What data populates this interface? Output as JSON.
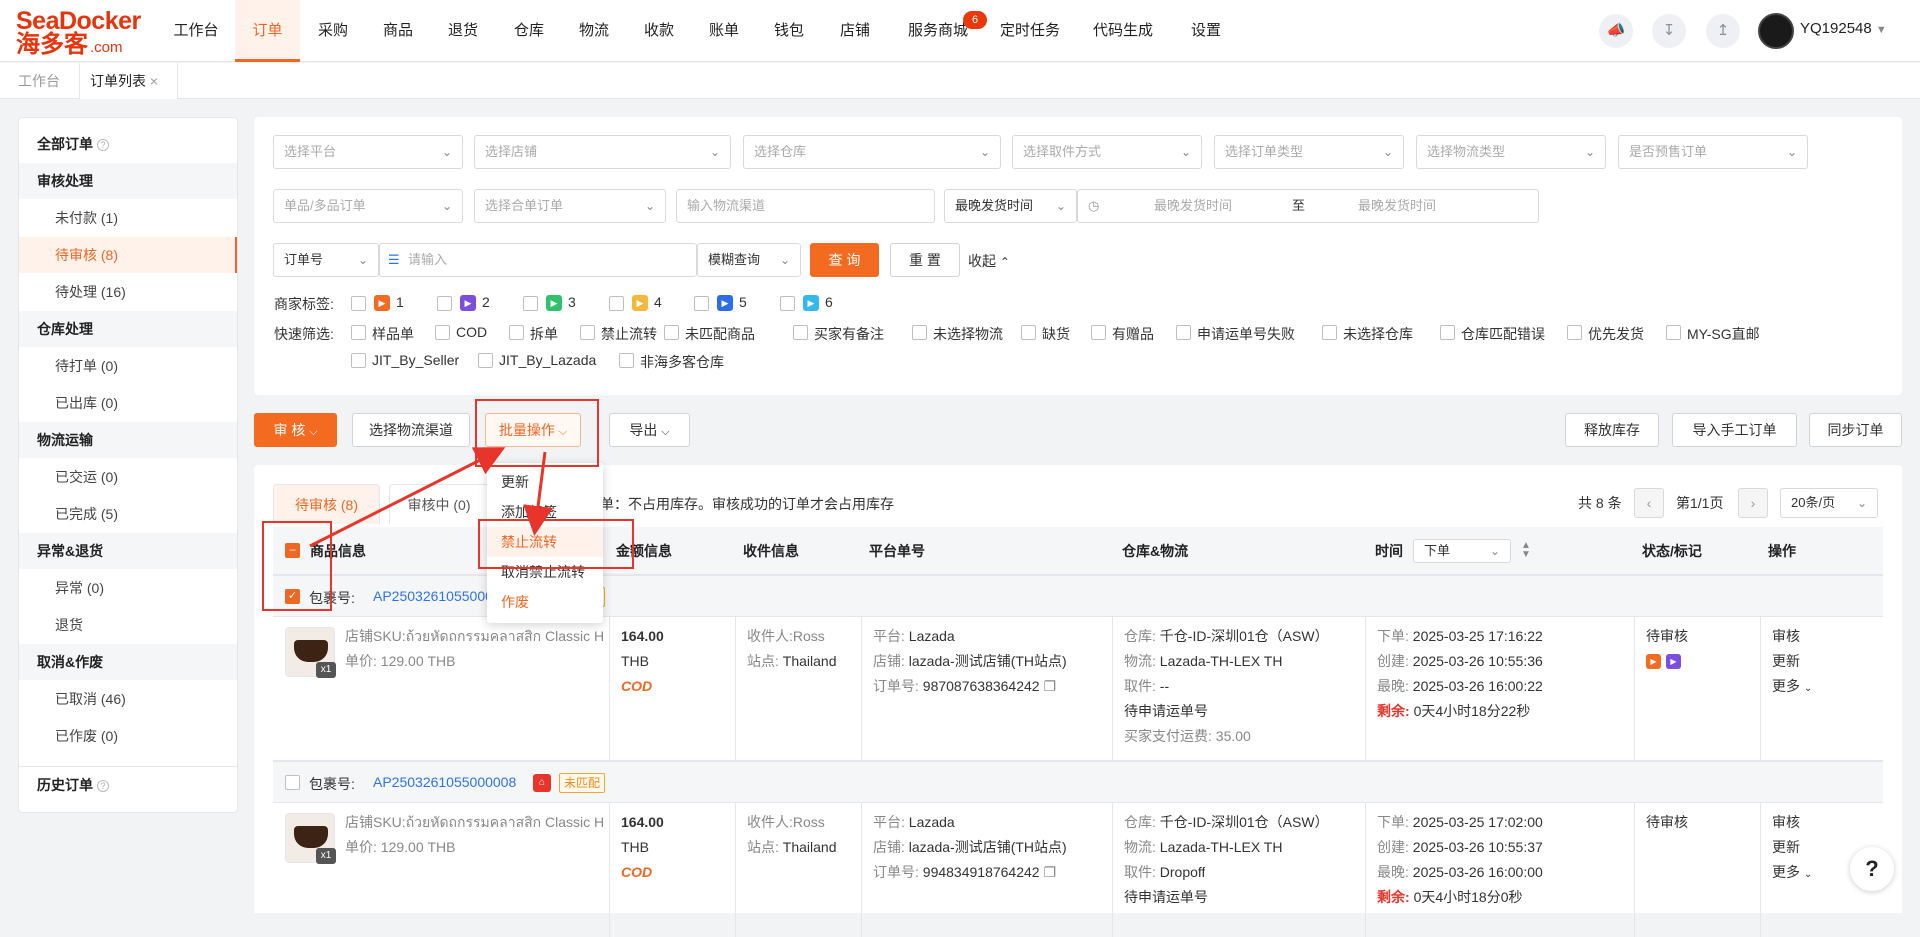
{
  "logo": {
    "brand": "SeaDocker",
    "cn": "海多客",
    "suffix": ".com"
  },
  "nav": {
    "items": [
      "工作台",
      "订单",
      "采购",
      "商品",
      "退货",
      "仓库",
      "物流",
      "收款",
      "账单",
      "钱包",
      "店铺",
      "服务商城",
      "定时任务",
      "代码生成",
      "设置"
    ],
    "badge": "6",
    "user": "YQ192548"
  },
  "tabs": {
    "workspace": "工作台",
    "order_list": "订单列表",
    "close": "×"
  },
  "sidebar": {
    "all": "全部订单",
    "items": [
      {
        "label": "审核处理",
        "type": "group"
      },
      {
        "label": "未付款 (1)",
        "type": "sub"
      },
      {
        "label": "待审核 (8)",
        "type": "sub"
      },
      {
        "label": "待处理 (16)",
        "type": "sub"
      },
      {
        "label": "仓库处理",
        "type": "group"
      },
      {
        "label": "待打单 (0)",
        "type": "sub"
      },
      {
        "label": "已出库 (0)",
        "type": "sub"
      },
      {
        "label": "物流运输",
        "type": "group"
      },
      {
        "label": "已交运 (0)",
        "type": "sub"
      },
      {
        "label": "已完成 (5)",
        "type": "sub"
      },
      {
        "label": "异常&退货",
        "type": "group"
      },
      {
        "label": "异常 (0)",
        "type": "sub"
      },
      {
        "label": "退货",
        "type": "sub"
      },
      {
        "label": "取消&作废",
        "type": "group"
      },
      {
        "label": "已取消 (46)",
        "type": "sub"
      },
      {
        "label": "已作废 (0)",
        "type": "sub"
      }
    ],
    "history": "历史订单"
  },
  "filters": {
    "row1": [
      "选择平台",
      "选择店铺",
      "选择仓库",
      "选择取件方式",
      "选择订单类型",
      "选择物流类型",
      "是否预售订单"
    ],
    "row2": {
      "single_multi": "单品/多品订单",
      "merge": "选择合单订单",
      "channel_ph": "输入物流渠道",
      "time_type": "最晚发货时间",
      "start_ph": "最晚发货时间",
      "to": "至",
      "end_ph": "最晚发货时间"
    },
    "row3": {
      "field": "订单号",
      "input_ph": "请输入",
      "mode": "模糊查询",
      "search": "查 询",
      "reset": "重 置",
      "collapse": "收起"
    },
    "merchant_label": "商家标签:",
    "merchant_flags": [
      {
        "num": "1",
        "color": "#f26b21"
      },
      {
        "num": "2",
        "color": "#7b4ee0"
      },
      {
        "num": "3",
        "color": "#2fc26b"
      },
      {
        "num": "4",
        "color": "#f5b83d"
      },
      {
        "num": "5",
        "color": "#2d6ee8"
      },
      {
        "num": "6",
        "color": "#35b8ef"
      }
    ],
    "quick_label": "快速筛选:",
    "quick": [
      "样品单",
      "COD",
      "拆单",
      "禁止流转",
      "未匹配商品",
      "买家有备注",
      "未选择物流",
      "缺货",
      "有赠品",
      "申请运单号失败",
      "未选择仓库",
      "仓库匹配错误",
      "优先发货",
      "MY-SG直邮"
    ],
    "quick2": [
      "JIT_By_Seller",
      "JIT_By_Lazada",
      "非海多客仓库"
    ]
  },
  "toolbar": {
    "audit": "审 核",
    "choose_channel": "选择物流渠道",
    "batch": "批量操作",
    "export": "导出",
    "release": "释放库存",
    "import": "导入手工订单",
    "sync": "同步订单"
  },
  "dropdown": [
    "更新",
    "添加标签",
    "禁止流转",
    "取消禁止流转",
    "作废"
  ],
  "table": {
    "tab_pending": "待审核 (8)",
    "tab_auditing": "审核中 (0)",
    "notice": "单：不占用库存。审核成功的订单才会占用库存",
    "total": "共 8 条",
    "page": "第1/1页",
    "per_page": "20条/页",
    "headers": [
      "商品信息",
      "金额信息",
      "收件信息",
      "平台单号",
      "仓库&物流",
      "时间",
      "状态/标记",
      "操作"
    ],
    "time_select": "下单"
  },
  "orders": [
    {
      "pkg_label": "包裹号:",
      "pkg_no": "AP2503261055000008",
      "pkg_tag": "未匹配",
      "sku_label": "店铺SKU:",
      "sku": "ถ้วยหัดถกรรมคลาสสิก Classic Handicraft Cup",
      "price_label": "单价:",
      "price": "129.00 THB",
      "qty": "x1",
      "amount": "164.00",
      "currency": "THB",
      "cod": "COD",
      "recv_label": "收件人:",
      "recv": "Ross",
      "site_label": "站点:",
      "site": "Thailand",
      "plat_label": "平台:",
      "plat": "Lazada",
      "shop_label": "店铺:",
      "shop": "lazada-测试店铺(TH站点)",
      "ono_label": "订单号:",
      "ono": "987087638364242",
      "wh_label": "仓库:",
      "wh": "千仓-ID-深圳01仓（ASW）",
      "lg_label": "物流:",
      "lg": "Lazada-TH-LEX TH",
      "pick_label": "取件:",
      "pick": "--",
      "apply": "待申请运单号",
      "freight": "买家支付运费: 35.00",
      "t1_label": "下单:",
      "t1": "2025-03-25 17:16:22",
      "t2_label": "创建:",
      "t2": "2025-03-26 10:55:36",
      "t3_label": "最晚:",
      "t3": "2025-03-26 16:00:22",
      "remain_label": "剩余:",
      "remain": "0天4小时18分22秒",
      "status": "待审核",
      "op1": "审核",
      "op2": "更新",
      "op3": "更多"
    },
    {
      "pkg_label": "包裹号:",
      "pkg_no": "AP2503261055000008",
      "pkg_tag": "未匹配",
      "sku_label": "店铺SKU:",
      "sku": "ถ้วยหัดถกรรมคลาสสิก Classic Handicraft Cup",
      "price_label": "单价:",
      "price": "129.00 THB",
      "qty": "x1",
      "amount": "164.00",
      "currency": "THB",
      "cod": "COD",
      "recv_label": "收件人:",
      "recv": "Ross",
      "site_label": "站点:",
      "site": "Thailand",
      "plat_label": "平台:",
      "plat": "Lazada",
      "shop_label": "店铺:",
      "shop": "lazada-测试店铺(TH站点)",
      "ono_label": "订单号:",
      "ono": "994834918764242",
      "wh_label": "仓库:",
      "wh": "千仓-ID-深圳01仓（ASW）",
      "lg_label": "物流:",
      "lg": "Lazada-TH-LEX TH",
      "pick_label": "取件:",
      "pick": "Dropoff",
      "apply": "待申请运单号",
      "t1_label": "下单:",
      "t1": "2025-03-25 17:02:00",
      "t2_label": "创建:",
      "t2": "2025-03-26 10:55:37",
      "t3_label": "最晚:",
      "t3": "2025-03-26 16:00:00",
      "remain_label": "剩余:",
      "remain": "0天4小时18分0秒",
      "status": "待审核",
      "op1": "审核",
      "op2": "更新",
      "op3": "更多"
    }
  ],
  "help": "?",
  "colors": {
    "accent": "#f06623",
    "link": "#2d74e8",
    "annotation": "#e8352b"
  }
}
